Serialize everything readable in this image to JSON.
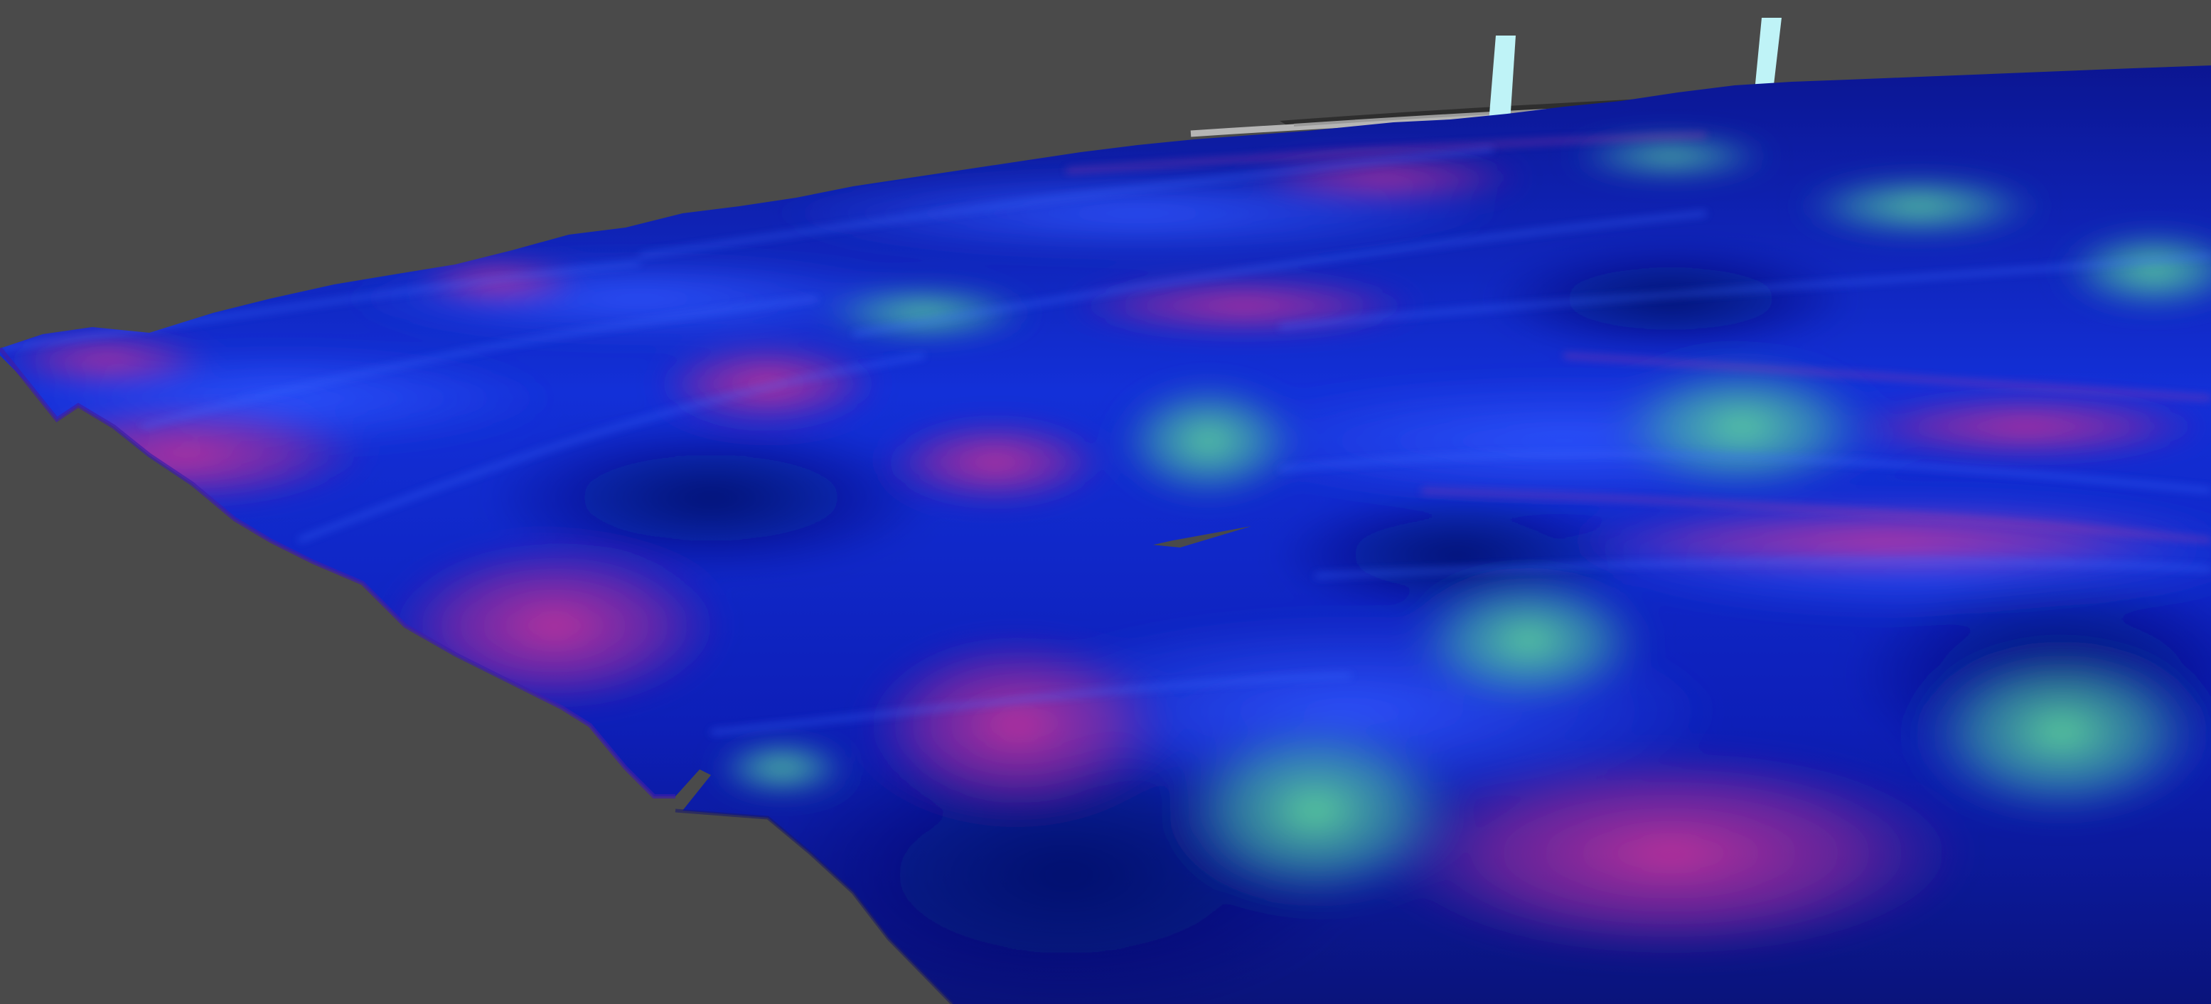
{
  "scene": {
    "background_color": "#4a4a4a",
    "surface_palette": {
      "deep_blue": "#0a0f7a",
      "blue": "#1428e6",
      "bright_blue": "#2a4dff",
      "magenta": "#c0309a",
      "teal": "#4fb8a0",
      "green": "#5ed68a"
    },
    "markers": [
      {
        "name": "marker-left",
        "color": "#bff3f7"
      },
      {
        "name": "marker-right",
        "color": "#bff3f7"
      }
    ],
    "horizon_ring_color": "#b5b5b5",
    "track_color": "#2e2e2e",
    "track_stripe_color": "#d6b34a"
  }
}
